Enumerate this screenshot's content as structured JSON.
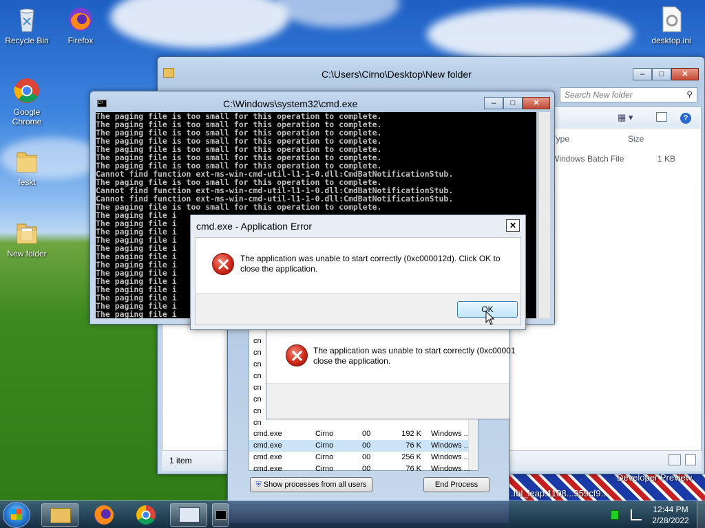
{
  "desktop": {
    "icons": [
      {
        "label": "Recycle Bin"
      },
      {
        "label": "Firefox"
      },
      {
        "label": "Google Chrome"
      },
      {
        "label": "feskt"
      },
      {
        "label": "New folder"
      },
      {
        "label": "desktop.ini"
      }
    ],
    "watermark": "Developer Preview",
    "watermark_build": ".fbl_leap.1108...959cf9..."
  },
  "explorer": {
    "title": "C:\\Users\\Cirno\\Desktop\\New folder",
    "search_placeholder": "Search New folder",
    "columns": {
      "type": "Type",
      "size": "Size"
    },
    "file_type": "Windows Batch File",
    "file_size": "1 KB",
    "status": "1 item"
  },
  "cmd": {
    "title": "C:\\Windows\\system32\\cmd.exe",
    "lines": [
      "The paging file is too small for this operation to complete.",
      "The paging file is too small for this operation to complete.",
      "The paging file is too small for this operation to complete.",
      "The paging file is too small for this operation to complete.",
      "The paging file is too small for this operation to complete.",
      "The paging file is too small for this operation to complete.",
      "The paging file is too small for this operation to complete.",
      "Cannot find function ext-ms-win-cmd-util-l1-1-0.dll:CmdBatNotificationStub.",
      "The paging file is too small for this operation to complete.",
      "Cannot find function ext-ms-win-cmd-util-l1-1-0.dll:CmdBatNotificationStub.",
      "Cannot find function ext-ms-win-cmd-util-l1-1-0.dll:CmdBatNotificationStub.",
      "The paging file is too small for this operation to complete.",
      "The paging file i",
      "The paging file i",
      "The paging file i",
      "The paging file i",
      "The paging file i",
      "The paging file i",
      "The paging file i",
      "The paging file i",
      "The paging file i",
      "The paging file i",
      "The paging file i",
      "The paging file i",
      "The paging file i"
    ]
  },
  "error_dialog": {
    "title": "cmd.exe - Application Error",
    "message_line1": "The application was unable to start correctly (0xc000012d). Click OK to",
    "message_line2": "close the application.",
    "ok_label": "OK"
  },
  "error_dialog_behind": {
    "message_line1": "The application was unable to start correctly (0xc00001",
    "message_line2": "close the application."
  },
  "task_manager": {
    "partial_rows": [
      "cn",
      "cn",
      "cn",
      "cn",
      "cn",
      "cn",
      "cn",
      "cn"
    ],
    "rows": [
      {
        "name": "cmd.exe",
        "user": "Cirno",
        "cpu": "00",
        "mem": "192 K",
        "desc": "Windows ..."
      },
      {
        "name": "cmd.exe",
        "user": "Cirno",
        "cpu": "00",
        "mem": "76 K",
        "desc": "Windows ..."
      },
      {
        "name": "cmd.exe",
        "user": "Cirno",
        "cpu": "00",
        "mem": "256 K",
        "desc": "Windows ..."
      },
      {
        "name": "cmd.exe",
        "user": "Cirno",
        "cpu": "00",
        "mem": "76 K",
        "desc": "Windows ..."
      }
    ],
    "show_all_label": "Show processes from all users",
    "end_process_label": "End Process"
  },
  "taskbar": {
    "time": "12:44 PM",
    "date": "2/28/2022"
  },
  "colors": {
    "console_bg": "#000000",
    "console_text": "#c0c0c0",
    "error_red": "#d02a1a",
    "selected_row": "#cce4f7"
  }
}
